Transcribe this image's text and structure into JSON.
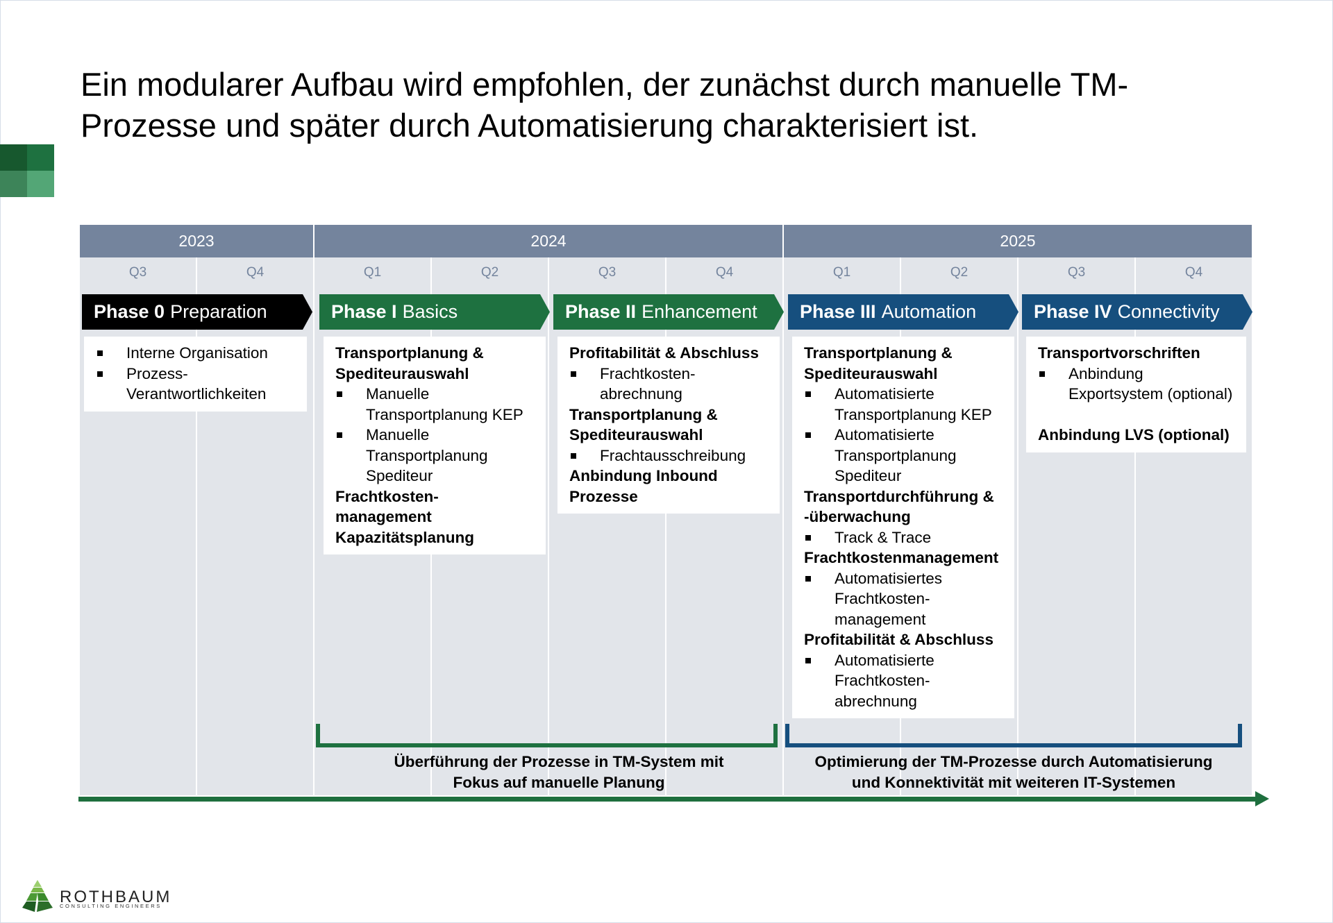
{
  "title": {
    "line1": "Ein modularer Aufbau wird empfohlen, der zunächst durch manuelle TM-",
    "line2": "Prozesse und später durch Automatisierung charakterisiert ist."
  },
  "colors": {
    "year_header": "#74849d",
    "grid_bg": "#e2e5ea",
    "phase0": "#000000",
    "green": "#1e7140",
    "blue": "#164f7e",
    "arrow": "#1e6f3e"
  },
  "timeline": {
    "years": [
      {
        "label": "2023",
        "quarters": [
          "Q3",
          "Q4"
        ]
      },
      {
        "label": "2024",
        "quarters": [
          "Q1",
          "Q2",
          "Q3",
          "Q4"
        ]
      },
      {
        "label": "2025",
        "quarters": [
          "Q1",
          "Q2",
          "Q3",
          "Q4"
        ]
      }
    ]
  },
  "phases": [
    {
      "bold": "Phase 0",
      "name": "Preparation",
      "items": [
        {
          "type": "bullet",
          "text": "Interne Organisation"
        },
        {
          "type": "bullet",
          "text": "Prozess-\nVerantwortlichkeiten"
        }
      ]
    },
    {
      "bold": "Phase I",
      "name": "Basics",
      "items": [
        {
          "type": "heading",
          "text": "Transportplanung & Spediteurauswahl"
        },
        {
          "type": "bullet",
          "text": "Manuelle Transportplanung KEP"
        },
        {
          "type": "bullet",
          "text": "Manuelle Transportplanung Spediteur"
        },
        {
          "type": "heading",
          "text": "Frachtkosten-\nmanagement"
        },
        {
          "type": "heading",
          "text": "Kapazitätsplanung"
        }
      ]
    },
    {
      "bold": "Phase II",
      "name": "Enhancement",
      "items": [
        {
          "type": "heading",
          "text": "Profitabilität & Abschluss"
        },
        {
          "type": "bullet",
          "text": "Frachtkosten-\nabrechnung"
        },
        {
          "type": "heading",
          "text": "Transportplanung & Spediteurauswahl"
        },
        {
          "type": "bullet",
          "text": "Frachtausschreibung"
        },
        {
          "type": "heading",
          "text": "Anbindung Inbound Prozesse"
        }
      ]
    },
    {
      "bold": "Phase III",
      "name": "Automation",
      "items": [
        {
          "type": "heading",
          "text": "Transportplanung & Spediteurauswahl"
        },
        {
          "type": "bullet",
          "text": "Automatisierte Transportplanung KEP"
        },
        {
          "type": "bullet",
          "text": "Automatisierte Transportplanung Spediteur"
        },
        {
          "type": "heading",
          "text": "Transportdurchführung &\n-überwachung"
        },
        {
          "type": "bullet",
          "text": "Track & Trace"
        },
        {
          "type": "heading",
          "text": "Frachtkostenmanagement"
        },
        {
          "type": "bullet",
          "text": "Automatisiertes Frachtkosten-\nmanagement"
        },
        {
          "type": "heading",
          "text": "Profitabilität & Abschluss"
        },
        {
          "type": "bullet",
          "text": "Automatisierte Frachtkosten-\nabrechnung"
        }
      ]
    },
    {
      "bold": "Phase IV",
      "name": "Connectivity",
      "items": [
        {
          "type": "heading",
          "text": "Transportvorschriften"
        },
        {
          "type": "bullet",
          "text": "Anbindung Exportsystem (optional)"
        },
        {
          "type": "spacer",
          "text": ""
        },
        {
          "type": "heading",
          "text": "Anbindung LVS (optional)"
        }
      ]
    }
  ],
  "brackets": [
    {
      "label_line1": "Überführung der Prozesse in TM-System mit",
      "label_line2": "Fokus auf manuelle Planung"
    },
    {
      "label_line1": "Optimierung der TM-Prozesse durch Automatisierung",
      "label_line2": "und Konnektivität mit weiteren IT-Systemen"
    }
  ],
  "logo": {
    "name": "ROTHBAUM",
    "tagline": "CONSULTING ENGINEERS"
  }
}
